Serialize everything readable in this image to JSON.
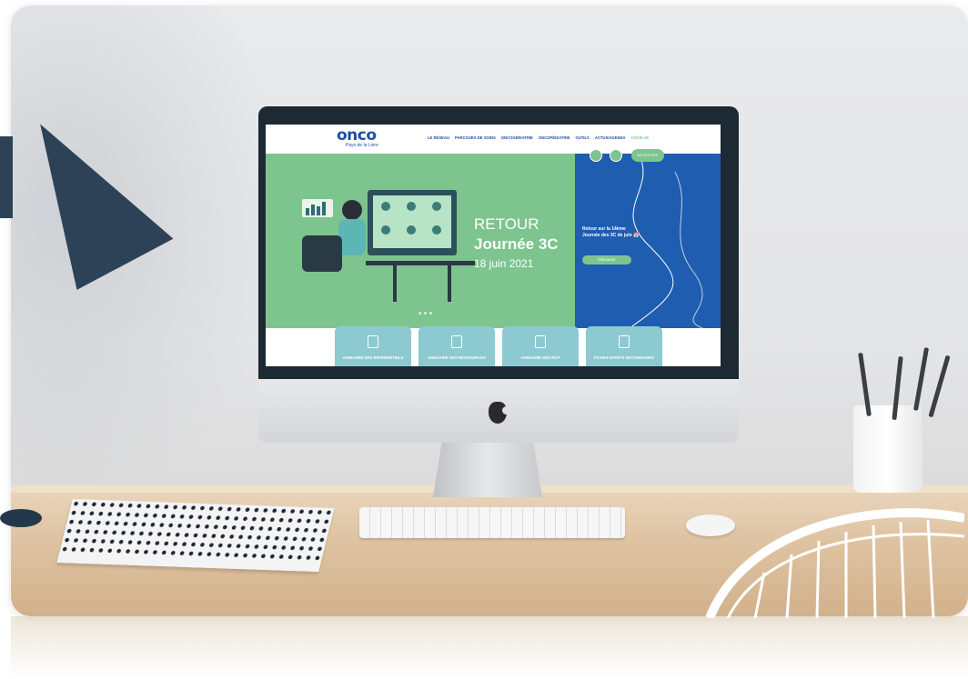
{
  "site": {
    "logo_word": "onco",
    "logo_sub": "Pays de la Loire",
    "nav": [
      "LE RÉSEAU",
      "PARCOURS DE SOINS",
      "ONCOGÉRIATRIE",
      "ONCOPÉDIATRIE",
      "OUTILS",
      "ACTUS/AGENDA",
      "COVID-19"
    ],
    "access_label": "ACCÈS RCC"
  },
  "hero": {
    "line1": "RETOUR",
    "line2": "Journée 3C",
    "line3": "18 juin 2021"
  },
  "panel": {
    "text": "Retour sur la 14ème Journée des 3C de juin 📅",
    "button": "Découvrir"
  },
  "cards": [
    {
      "label": "ANNUAIRE DES RÉFÉRENTIELS",
      "icon": "document-icon"
    },
    {
      "label": "ANNUAIRE DES RESSOURCES",
      "icon": "book-icon"
    },
    {
      "label": "ANNUAIRE DES RCP",
      "icon": "notebook-icon"
    },
    {
      "label": "FICHES EFFETS SECONDAIRES",
      "icon": "file-icon"
    }
  ],
  "colors": {
    "brand_blue": "#1f5db0",
    "brand_green": "#7dc48f",
    "card_teal": "#8cc9d1"
  }
}
